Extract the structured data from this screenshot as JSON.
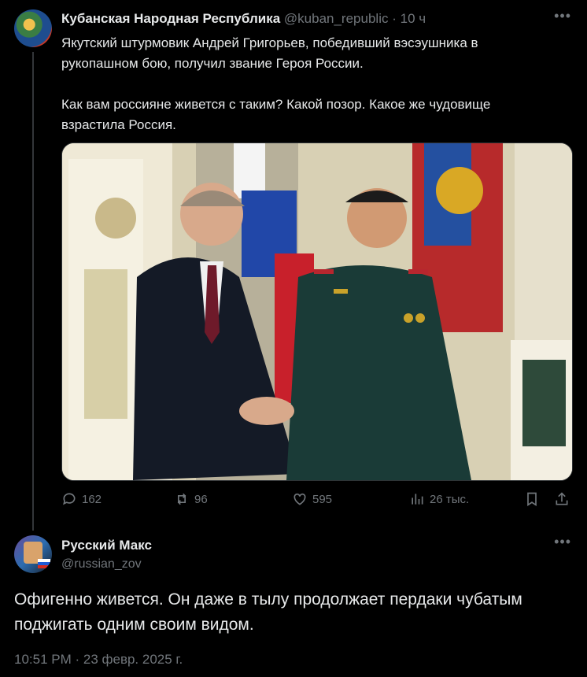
{
  "tweet1": {
    "author": "Кубанская Народная Республика",
    "handle": "@kuban_republic",
    "sep": "·",
    "time": "10 ч",
    "text": "Якутский штурмовик Андрей Григорьев, победивший вэсэушника в\nрукопашном бою, получил звание Героя России.\n\nКак вам россияне живется с таким? Какой позор. Какое же чудовище\nвзрастила Россия.",
    "replies": "162",
    "reposts": "96",
    "likes": "595",
    "views": "26 тыс."
  },
  "tweet2": {
    "author": "Русский Макс",
    "handle": "@russian_zov",
    "text": "Офигенно живется. Он даже в тылу продолжает пердаки чубатым\nподжигать одним своим видом.",
    "timestamp": "10:51 PM · 23 февр. 2025 г."
  },
  "icons": [
    "more-icon",
    "reply-icon",
    "repost-icon",
    "like-icon",
    "views-icon",
    "bookmark-icon",
    "share-icon"
  ]
}
